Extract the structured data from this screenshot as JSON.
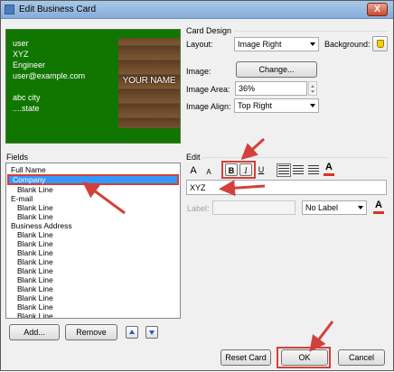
{
  "window": {
    "title": "Edit Business Card",
    "close_glyph": "X"
  },
  "preview": {
    "lines": [
      "user",
      "XYZ",
      "Engineer",
      "user@example.com",
      "",
      "abc city",
      "....state"
    ],
    "image_text": "YOUR NAME",
    "background_color": "#117600"
  },
  "card_design": {
    "group_label": "Card Design",
    "layout_label": "Layout:",
    "layout_value": "Image Right",
    "background_label": "Background:",
    "image_label": "Image:",
    "change_button": "Change...",
    "image_area_label": "Image Area:",
    "image_area_value": "36%",
    "image_align_label": "Image Align:",
    "image_align_value": "Top Right"
  },
  "fields": {
    "group_label": "Fields",
    "items": [
      {
        "label": "Full Name",
        "sub": false
      },
      {
        "label": "Company",
        "sub": false,
        "selected": true
      },
      {
        "label": "Blank Line",
        "sub": true
      },
      {
        "label": "E-mail",
        "sub": false
      },
      {
        "label": "Blank Line",
        "sub": true
      },
      {
        "label": "Blank Line",
        "sub": true
      },
      {
        "label": "Business Address",
        "sub": false
      },
      {
        "label": "Blank Line",
        "sub": true
      },
      {
        "label": "Blank Line",
        "sub": true
      },
      {
        "label": "Blank Line",
        "sub": true
      },
      {
        "label": "Blank Line",
        "sub": true
      },
      {
        "label": "Blank Line",
        "sub": true
      },
      {
        "label": "Blank Line",
        "sub": true
      },
      {
        "label": "Blank Line",
        "sub": true
      },
      {
        "label": "Blank Line",
        "sub": true
      },
      {
        "label": "Blank Line",
        "sub": true
      },
      {
        "label": "Blank Line",
        "sub": true
      }
    ],
    "add_button": "Add...",
    "remove_button": "Remove"
  },
  "edit": {
    "group_label": "Edit",
    "grow_font_glyph": "A",
    "shrink_font_glyph": "A",
    "bold_glyph": "B",
    "italic_glyph": "I",
    "underline_glyph": "U",
    "font_color_glyph": "A",
    "text_value": "XYZ",
    "label_label": "Label:",
    "label_value": "",
    "label_position_value": "No Label"
  },
  "footer": {
    "reset_button": "Reset Card",
    "ok_button": "OK",
    "cancel_button": "Cancel"
  },
  "colors": {
    "annotation_red": "#d3403a",
    "selection_blue": "#3399ff"
  }
}
